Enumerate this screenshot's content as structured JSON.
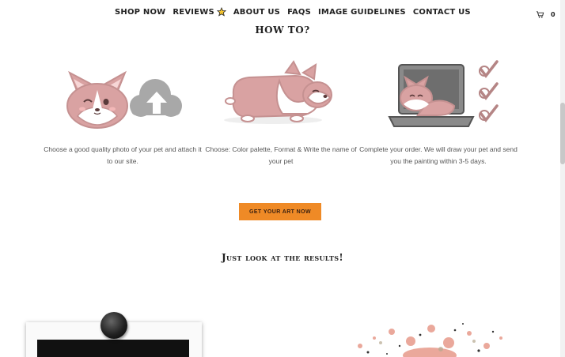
{
  "nav": {
    "items": [
      {
        "label": "SHOP NOW"
      },
      {
        "label": "REVIEWS"
      },
      {
        "label": "ABOUT US"
      },
      {
        "label": "FAQS"
      },
      {
        "label": "IMAGE GUIDELINES"
      },
      {
        "label": "CONTACT US"
      }
    ],
    "cart_count": "0",
    "icons": {
      "reviews": "star-icon",
      "cart": "cart-icon"
    }
  },
  "how_to": {
    "title": "HOW TO?",
    "steps": [
      {
        "text": "Choose a good quality photo of your pet and attach it to our site.",
        "icon": "corgi-upload-cloud-illustration"
      },
      {
        "text": "Choose: Color palette, Format & Write the name of your pet",
        "icon": "corgi-lying-illustration"
      },
      {
        "text": "Complete your order. We will draw your pet and send you the painting within 3-5 days.",
        "icon": "corgi-laptop-checklist-illustration"
      }
    ]
  },
  "cta": {
    "label": "GET YOUR ART NOW"
  },
  "results": {
    "title": "Just look at the results!"
  },
  "colors": {
    "accent": "#ef8a26",
    "illustration_pink": "#d9a2a2",
    "cloud_gray": "#a8a8a8"
  }
}
